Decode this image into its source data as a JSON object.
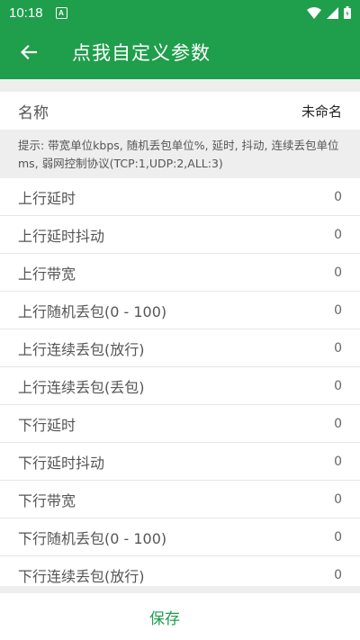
{
  "status_bar": {
    "time": "10:18",
    "app_icon_letter": "A"
  },
  "app_bar": {
    "title": "点我自定义参数"
  },
  "name_field": {
    "label": "名称",
    "value": "未命名"
  },
  "hint": {
    "text": "提示: 带宽单位kbps, 随机丢包单位%, 延时, 抖动, 连续丢包单位ms, 弱网控制协议(TCP:1,UDP:2,ALL:3)"
  },
  "params": [
    {
      "label": "上行延时",
      "value": "0"
    },
    {
      "label": "上行延时抖动",
      "value": "0"
    },
    {
      "label": "上行带宽",
      "value": "0"
    },
    {
      "label": "上行随机丢包(0 - 100)",
      "value": "0"
    },
    {
      "label": "上行连续丢包(放行)",
      "value": "0"
    },
    {
      "label": "上行连续丢包(丢包)",
      "value": "0"
    },
    {
      "label": "下行延时",
      "value": "0"
    },
    {
      "label": "下行延时抖动",
      "value": "0"
    },
    {
      "label": "下行带宽",
      "value": "0"
    },
    {
      "label": "下行随机丢包(0 - 100)",
      "value": "0"
    },
    {
      "label": "下行连续丢包(放行)",
      "value": "0"
    }
  ],
  "footer": {
    "save_label": "保存"
  },
  "colors": {
    "primary": "#1f9e4c",
    "divider_bg": "#eeeeee"
  }
}
